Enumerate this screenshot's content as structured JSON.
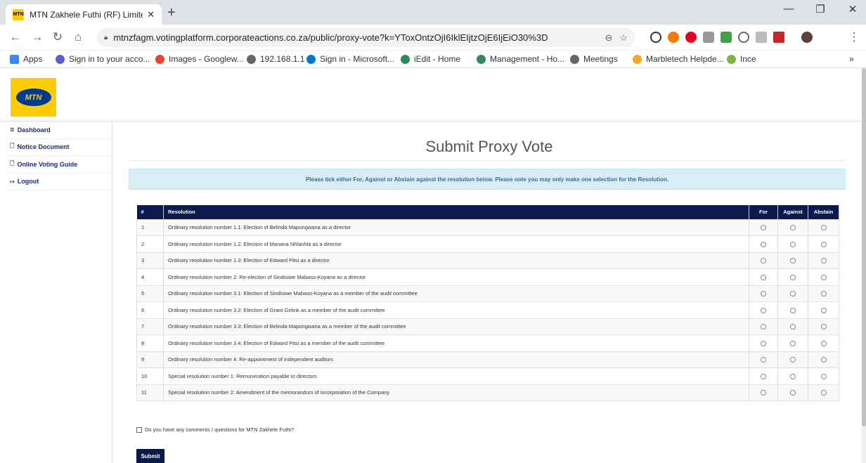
{
  "browser": {
    "tab_title": "MTN Zakhele Futhi (RF) Limited -",
    "tab_favicon_text": "MTN",
    "url": "mtnzfagm.votingplatform.corporateactions.co.za/public/proxy-vote?k=YToxOntzOjI6IklEIjtzOjE6IjEiO30%3D",
    "bookmarks": [
      {
        "label": "Apps",
        "color": "#4285f4"
      },
      {
        "label": "Sign in to your acco...",
        "color": "#5b5fc7"
      },
      {
        "label": "Images - Googlew...",
        "color": "#ea4335"
      },
      {
        "label": "192.168.1.1",
        "color": "#666666"
      },
      {
        "label": "Sign in - Microsoft...",
        "color": "#0078d4"
      },
      {
        "label": "iEdit - Home",
        "color": "#2e8b57"
      },
      {
        "label": "Management - Ho...",
        "color": "#2e8b57"
      },
      {
        "label": "Meetings",
        "color": "#666666"
      },
      {
        "label": "Marbletech Helpde...",
        "color": "#f5a623"
      },
      {
        "label": "Ince",
        "color": "#7cb342"
      }
    ],
    "bookmarks_overflow": "»"
  },
  "logo": {
    "text": "MTN",
    "bg_color": "#ffcb05",
    "oval_color": "#003a8c"
  },
  "sidebar": {
    "items": [
      {
        "label": "Dashboard",
        "icon": "≣"
      },
      {
        "label": "Notice Document",
        "icon": "🗋"
      },
      {
        "label": "Online Voting Guide",
        "icon": "🗋"
      },
      {
        "label": "Logout",
        "icon": "↦"
      }
    ]
  },
  "main": {
    "title": "Submit Proxy Vote",
    "notice": "Please tick either For, Against or Abstain against the resolution below. Please note you may only make one selection for the Resolution.",
    "table": {
      "headers": [
        "#",
        "Resolution",
        "For",
        "Against",
        "Abstain"
      ],
      "rows": [
        {
          "num": "1",
          "text": "Ordinary resolution number 1.1: Election of Belinda Mapongwana as a director"
        },
        {
          "num": "2",
          "text": "Ordinary resolution number 1.2: Election of Manana Nhlanhla as a director"
        },
        {
          "num": "3",
          "text": "Ordinary resolution number 1.3: Election of Edward Pitsi as a director"
        },
        {
          "num": "4",
          "text": "Ordinary resolution number 2: Re-election of Sindisiwe Mabaso-Koyana as a director"
        },
        {
          "num": "5",
          "text": "Ordinary resolution number 3.1: Election of Sindisiwe Mabaso-Koyana as a member of the audit committee"
        },
        {
          "num": "6",
          "text": "Ordinary resolution number 3.2: Election of Grant Gelink as a member of the audit committee"
        },
        {
          "num": "7",
          "text": "Ordinary resolution number 3.3: Election of Belinda Mapongwana as a member of the audit committee"
        },
        {
          "num": "8",
          "text": "Ordinary resolution number 3.4: Election of Edward Pitsi as a member of the audit committee"
        },
        {
          "num": "9",
          "text": "Ordinary resolution number 4: Re-appointment of independent auditors"
        },
        {
          "num": "10",
          "text": "Special resolution number 1: Remuneration payable to directors"
        },
        {
          "num": "11",
          "text": "Special resolution number 2: Amendment of the memorandum of incorporation of the Company"
        }
      ]
    },
    "comments_label": "Do you have any comments / questions for MTN Zakhele Futhi?",
    "submit_label": "Submit"
  },
  "colors": {
    "header_navy": "#0a1a4d",
    "notice_bg": "#d9edf7",
    "notice_text": "#31708f",
    "sidebar_text": "#1a2b6b"
  }
}
